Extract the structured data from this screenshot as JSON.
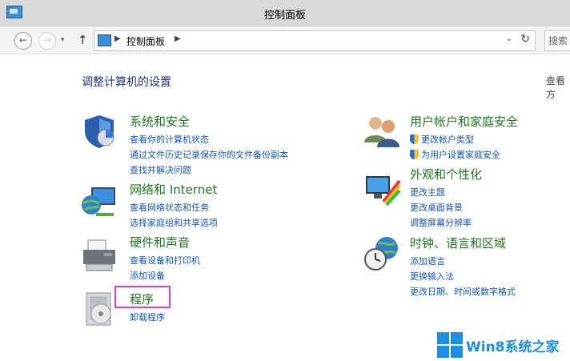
{
  "window": {
    "title": "控制面板"
  },
  "nav": {
    "back": "←",
    "forward": "→",
    "recent": "▾",
    "up": "↑"
  },
  "address": {
    "path_sep": "▶",
    "path": "控制面板",
    "path_sep2": "▶",
    "dropdown": "⌄",
    "refresh": "↻"
  },
  "search": {
    "placeholder": "搜索"
  },
  "main": {
    "heading": "调整计算机的设置",
    "view_label": "查看方"
  },
  "categories": {
    "system_security": {
      "title": "系统和安全",
      "links": [
        "查看你的计算机状态",
        "通过文件历史记录保存你的文件备份副本",
        "查找并解决问题"
      ]
    },
    "network": {
      "title": "网络和 Internet",
      "links": [
        "查看网络状态和任务",
        "选择家庭组和共享选项"
      ]
    },
    "hardware": {
      "title": "硬件和声音",
      "links": [
        "查看设备和打印机",
        "添加设备"
      ]
    },
    "programs": {
      "title": "程序",
      "links": [
        "卸载程序"
      ]
    },
    "user_accounts": {
      "title": "用户帐户和家庭安全",
      "links": [
        "更改帐户类型",
        "为用户设置家庭安全"
      ]
    },
    "appearance": {
      "title": "外观和个性化",
      "links": [
        "更改主题",
        "更改桌面背景",
        "调整屏幕分辨率"
      ]
    },
    "clock": {
      "title": "时钟、语言和区域",
      "links": [
        "添加语言",
        "更换输入法",
        "更改日期、时间或数字格式"
      ]
    }
  },
  "watermark": {
    "text": "Win8系统之家"
  }
}
